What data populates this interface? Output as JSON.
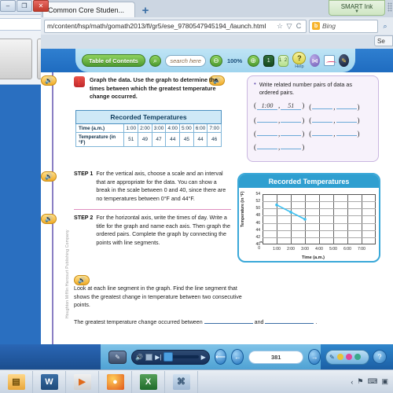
{
  "browser": {
    "tab_title": "Common Core Studen...",
    "newtab_label": "+",
    "url": "m/content/hsp/math/gomath2013/fl/gr5/ese_9780547945194_/launch.html",
    "search_placeholder": "Bing",
    "star_icon": "☆",
    "dropdown_icon": "▽",
    "reload_icon": "C",
    "bing_icon": "b",
    "magnifier_icon": "⌕",
    "smart_ink_label": "SMART Ink",
    "side_search_label": "Se",
    "win_min": "–",
    "win_max": "❐",
    "win_close": "✕"
  },
  "app_toolbar": {
    "toc_label": "Table of  Contents",
    "search_placeholder": "search here",
    "zoom_out_icon": "⊖",
    "zoom_level": "100%",
    "zoom_in_icon": "⊕",
    "single_page_label": "1",
    "double_page_label": "1 2",
    "help_icon": "?",
    "help_label": "Help",
    "tool_purple_icon": "⋈",
    "tool_chart_icon": "chart",
    "tool_dark_icon": "✎"
  },
  "lesson": {
    "speaker_icon": "🔊",
    "prompt_icon": "❗",
    "prompt_text": "Graph the data. Use the graph to determine the times between which the greatest temperature change occurred.",
    "copyright": "Houghton Mifflin Harcourt Publishing Company",
    "table": {
      "title": "Recorded Temperatures",
      "row_labels": [
        "Time (a.m.)",
        "Temperature (in °F)"
      ],
      "times": [
        "1:00",
        "2:00",
        "3:00",
        "4:00",
        "5:00",
        "6:00",
        "7:00"
      ],
      "temps": [
        "51",
        "49",
        "47",
        "44",
        "45",
        "44",
        "46"
      ]
    },
    "pairs_card": {
      "bullet": "•",
      "instruction": "Write related number pairs of data as ordered pairs.",
      "rows": [
        [
          {
            "x": "1:00",
            "y": "51",
            "filled": true
          },
          {
            "x": "",
            "y": "",
            "filled": false
          }
        ],
        [
          {
            "x": "",
            "y": "",
            "filled": false
          },
          {
            "x": "",
            "y": "",
            "filled": false
          }
        ],
        [
          {
            "x": "",
            "y": "",
            "filled": false
          },
          {
            "x": "",
            "y": "",
            "filled": false
          }
        ],
        [
          {
            "x": "",
            "y": "",
            "filled": false
          }
        ]
      ]
    },
    "step1_label": "STEP 1",
    "step1_text": "For the vertical axis, choose a scale and an interval that are appropriate for the data. You can show a break in the scale between 0 and 40, since there are no temperatures between 0°F and 44°F.",
    "step2_label": "STEP 2",
    "step2_text": "For the horizontal axis, write the times of day. Write a title for the graph and name each axis. Then graph the ordered pairs. Complete the graph by connecting the points with line segments.",
    "lookat_text": "Look at each line segment in the graph. Find the line segment that shows the greatest change in temperature between two consecutive points.",
    "answer_prefix": "The greatest temperature change occurred between",
    "answer_mid": "and",
    "answer_suffix": "."
  },
  "chart_data": {
    "type": "line",
    "title": "Recorded Temperatures",
    "xlabel": "Time (a.m.)",
    "ylabel": "Temperature (in °F)",
    "x_ticks": [
      "1:00",
      "2:00",
      "3:00",
      "4:00",
      "5:00",
      "6:00",
      "7:00"
    ],
    "y_ticks": [
      "54",
      "52",
      "50",
      "48",
      "46",
      "44",
      "42",
      "40",
      "0"
    ],
    "ylim": [
      40,
      54
    ],
    "axis_break": true,
    "grid": true,
    "legend": null,
    "x": [
      "1:00",
      "2:00",
      "3:00"
    ],
    "values": [
      51,
      49,
      47
    ],
    "point_color": "#3ec0f0",
    "line_color": "#3ec0f0",
    "note": "only first three points plotted"
  },
  "player": {
    "note_icon": "✎",
    "volume_icon": "🔊",
    "stop_icon": "■",
    "next_icon": "▶|",
    "play_icon": "▶",
    "first_icon": "⟵",
    "prev_icon": "←",
    "next_page_icon": "→",
    "page_number": "381",
    "pen_icon": "✎",
    "dot_colors": [
      "#e8c23a",
      "#e0489a",
      "#3aa88a"
    ],
    "help_icon": "?"
  },
  "taskbar": {
    "items": [
      {
        "name": "explorer",
        "glyph": "▤"
      },
      {
        "name": "word",
        "glyph": "W"
      },
      {
        "name": "media-player",
        "glyph": "▶"
      },
      {
        "name": "firefox",
        "glyph": "●"
      },
      {
        "name": "excel",
        "glyph": "X"
      },
      {
        "name": "remote-desktop",
        "glyph": "⌘"
      }
    ],
    "tray_icons": [
      "‹",
      "⚑",
      "⌨",
      "▣"
    ]
  }
}
